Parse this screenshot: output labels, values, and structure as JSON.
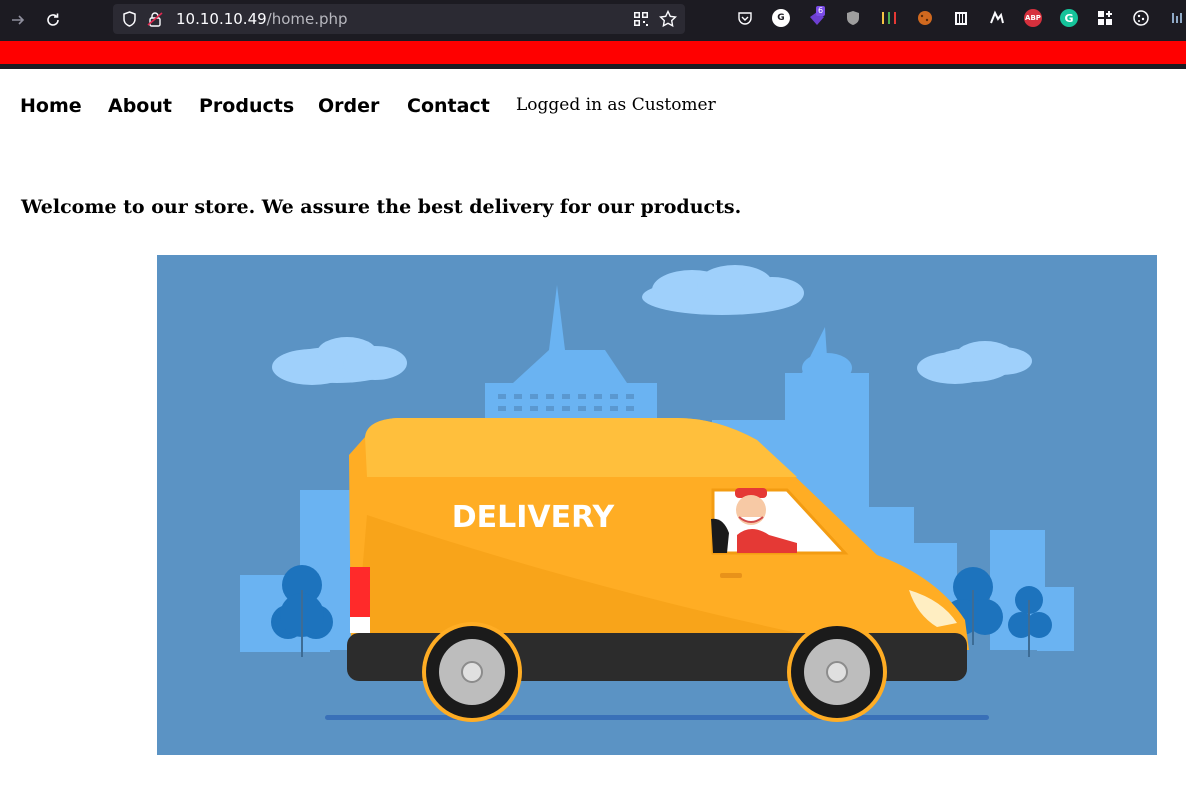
{
  "browser": {
    "url_host": "10.10.10.49",
    "url_path": "/home.php",
    "extensions": [
      {
        "name": "pocket-icon"
      },
      {
        "name": "g-extension-icon",
        "label": "G"
      },
      {
        "name": "purple-extension-icon",
        "badge": "6"
      },
      {
        "name": "shield-extension-icon"
      },
      {
        "name": "equalizer-extension-icon"
      },
      {
        "name": "cookie-extension-icon"
      },
      {
        "name": "trash-extension-icon"
      },
      {
        "name": "wappalyzer-icon"
      },
      {
        "name": "adblock-plus-icon",
        "label": "ABP"
      },
      {
        "name": "grammarly-icon",
        "label": "G"
      },
      {
        "name": "extensions-grid-icon"
      },
      {
        "name": "cookie-editor-icon"
      }
    ]
  },
  "nav": {
    "home": "Home",
    "about": "About",
    "products": "Products",
    "order": "Order",
    "contact": "Contact",
    "status": "Logged in as Customer"
  },
  "main": {
    "welcome": "Welcome to our store. We assure the best delivery for our products.",
    "hero_label": "DELIVERY"
  },
  "colors": {
    "accent_strip": "#ff0000",
    "hero_bg": "#5b93c4",
    "van": "#ffad24"
  }
}
